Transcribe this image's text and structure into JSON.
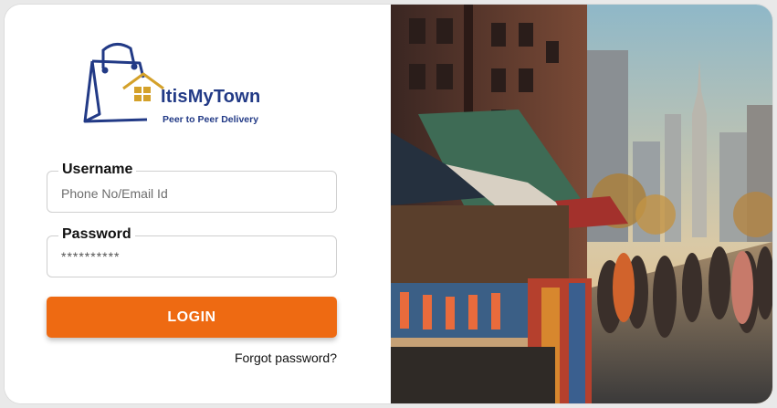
{
  "brand": {
    "name": "ItisMyTown",
    "tagline": "Peer to Peer Delivery",
    "colors": {
      "navy": "#223a86",
      "gold": "#d4a12a"
    },
    "icon": "shopping-bag-house-logo"
  },
  "form": {
    "username": {
      "label": "Username",
      "placeholder": "Phone No/Email Id",
      "value": ""
    },
    "password": {
      "label": "Password",
      "masked_value": "**********"
    },
    "login_label": "LOGIN",
    "forgot_label": "Forgot password?"
  },
  "theme": {
    "accent": "#ee6a12",
    "card_bg": "#ffffff",
    "page_bg": "#e9e9e9"
  },
  "hero_image": {
    "subject": "street-market-city-photo"
  }
}
